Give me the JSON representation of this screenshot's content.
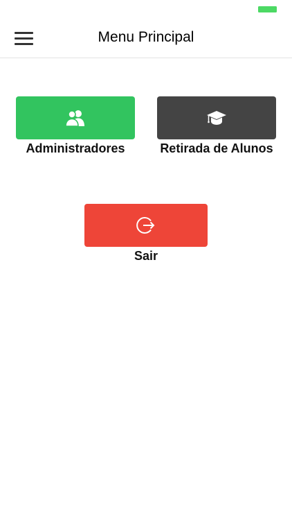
{
  "status_bar": {
    "battery_color": "#4cd964"
  },
  "nav": {
    "title": "Menu Principal",
    "menu_icon": "hamburger-menu-icon"
  },
  "menu": {
    "items": [
      {
        "label": "Administradores",
        "icon": "users-icon",
        "color": "#32c45f"
      },
      {
        "label": "Retirada de Alunos",
        "icon": "graduation-cap-icon",
        "color": "#444444"
      },
      {
        "label": "Sair",
        "icon": "logout-icon",
        "color": "#ee4538"
      }
    ]
  }
}
